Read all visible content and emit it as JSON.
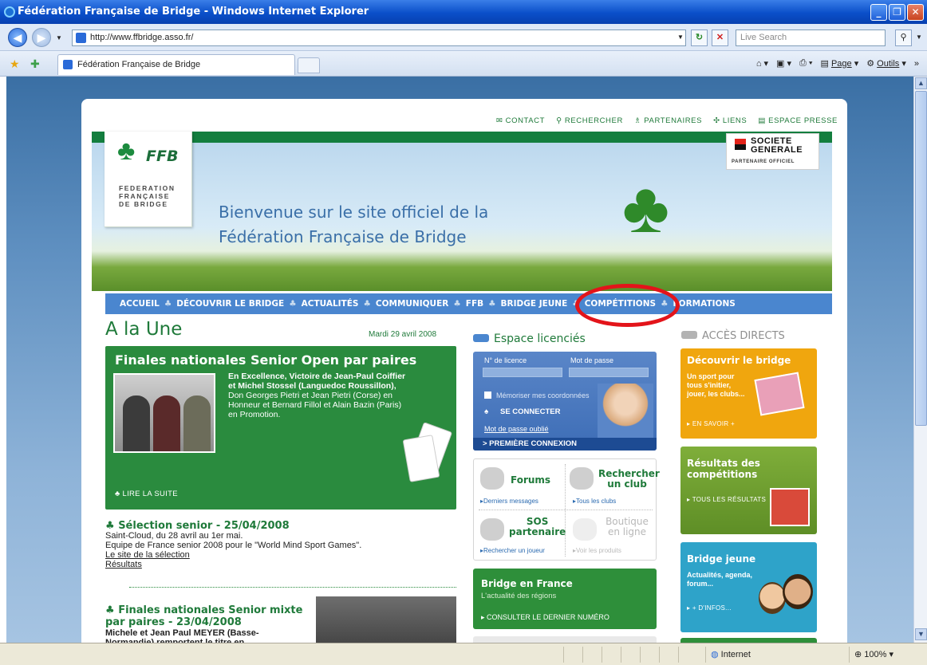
{
  "window": {
    "title": "Fédération Française de Bridge - Windows Internet Explorer"
  },
  "address": {
    "url": "http://www.ffbridge.asso.fr/",
    "search_placeholder": "Live Search"
  },
  "tab": {
    "label": "Fédération Française de Bridge"
  },
  "command_bar": {
    "page": "Page",
    "tools": "Outils"
  },
  "status": {
    "zone": "Internet",
    "zoom": "100%"
  },
  "site": {
    "top_links": [
      "CONTACT",
      "RECHERCHER",
      "PARTENAIRES",
      "LIENS",
      "ESPACE PRESSE"
    ],
    "logo": {
      "brand": "FFB",
      "line1": "FEDERATION",
      "line2": "FRANÇAISE",
      "line3": "DE BRIDGE"
    },
    "welcome": {
      "line1": "Bienvenue sur le site officiel de la",
      "line2": "Fédération Française de Bridge"
    },
    "sponsor": {
      "line1": "SOCIETE",
      "line2": "GENERALE",
      "tag": "PARTENAIRE OFFICIEL"
    },
    "menu": [
      "ACCUEIL",
      "DÉCOUVRIR LE BRIDGE",
      "ACTUALITÉS",
      "COMMUNIQUER",
      "FFB",
      "BRIDGE JEUNE",
      "COMPÉTITIONS",
      "FORMATIONS"
    ],
    "une": {
      "heading": "A la Une",
      "date": "Mardi 29 avril 2008"
    },
    "feature": {
      "title": "Finales nationales Senior Open par paires",
      "bold_text": "En Excellence, Victoire de Jean-Paul Coiffier et Michel Stossel (Languedoc Roussillon),",
      "text": " Don Georges Pietri et Jean Pietri (Corse) en Honneur et Bernard Fillol et Alain Bazin (Paris) en Promotion.",
      "read_more": "LIRE LA SUITE"
    },
    "news1": {
      "title": "Sélection senior - 25/04/2008",
      "line1": "Saint-Cloud, du 28 avril au 1er mai.",
      "line2": "Equipe de France senior 2008  pour le \"World Mind Sport Games\".",
      "link1": "Le site de la sélection",
      "link2": "Résultats"
    },
    "news2": {
      "title": "Finales nationales Senior mixte par paires - 23/04/2008",
      "text": "Michele et Jean Paul MEYER (Basse-Normandie) remportent le titre en"
    },
    "licencies": {
      "title": "Espace licenciés",
      "license_label": "N° de licence",
      "password_label": "Mot de passe",
      "remember": "Mémoriser mes coordonnées",
      "connect": "SE CONNECTER",
      "forgot": "Mot de passe oublié",
      "first": "> PREMIÈRE CONNEXION"
    },
    "tools": {
      "forums": "Forums",
      "forums_link": "▸Derniers messages",
      "club": "Rechercher un club",
      "club_link": "▸Tous les clubs",
      "sos": "SOS partenaire",
      "sos_link": "▸Rechercher un joueur",
      "shop": "Boutique en ligne",
      "shop_link": "▸Voir les produits"
    },
    "bridge_france": {
      "title": "Bridge en France",
      "subtitle": "L'actualité des régions",
      "link": "▸ CONSULTER LE DERNIER NUMÉRO"
    },
    "direct": {
      "title": "ACCÈS DIRECTS",
      "ad1": {
        "title": "Découvrir le bridge",
        "desc": "Un sport pour tous s'initier, jouer, les clubs...",
        "link": "▸ EN SAVOIR +"
      },
      "ad2": {
        "title": "Résultats des compétitions",
        "link": "▸ TOUS LES RÉSULTATS"
      },
      "ad3": {
        "title": "Bridge jeune",
        "desc": "Actualités, agenda, forum...",
        "link": "▸ + D'INFOS..."
      }
    }
  },
  "colors": {
    "accent_green": "#1f7a3a",
    "menu_blue": "#4a86cf",
    "highlight_red": "#e3141a"
  }
}
